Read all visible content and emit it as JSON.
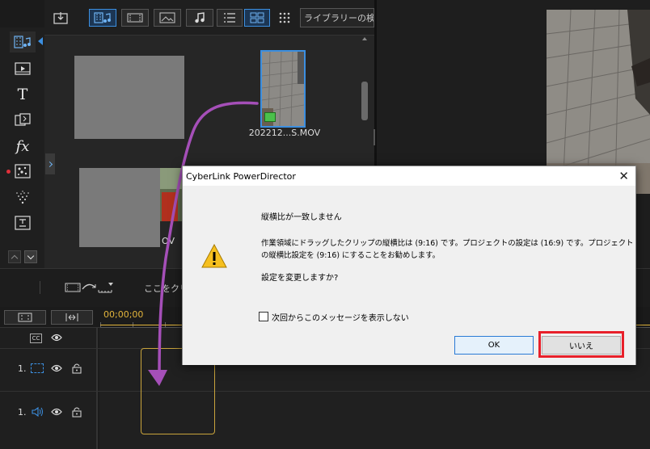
{
  "library": {
    "search_placeholder": "ライブラリーの検索",
    "clip_name": "202212...S.MOV",
    "clip2_suffix": "OV"
  },
  "timeline": {
    "timecode": "00;00;00",
    "hint_text": "ここをクリ",
    "track1_label": "1.",
    "track2_label": "1."
  },
  "dialog": {
    "title": "CyberLink PowerDirector",
    "close": "✕",
    "heading": "縦横比が一致しません",
    "message_line1": "作業領域にドラッグしたクリップの縦横比は (9:16) です。プロジェクトの設定は (16:9) です。プロジェクト",
    "message_line2": "の縦横比設定を (9:16) にすることをお勧めします。",
    "question": "設定を変更しますか?",
    "checkbox_label": "次回からこのメッセージを表示しない",
    "checkbox_checked": false,
    "ok_label": "OK",
    "no_label": "いいえ"
  },
  "colors": {
    "accent": "#3c8fe0",
    "annotation_arrow": "#a54fb8",
    "highlight_box": "#e8202a",
    "timeline_playhead": "#e3b53c"
  }
}
